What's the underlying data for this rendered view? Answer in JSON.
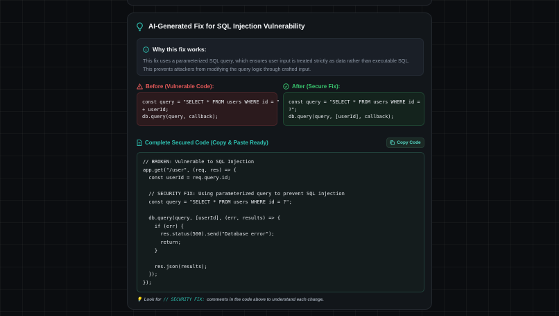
{
  "card": {
    "title": "AI-Generated Fix for SQL Injection Vulnerability",
    "title_icon": "lightbulb-icon"
  },
  "why": {
    "heading": "Why this fix works:",
    "icon": "info-icon",
    "text": "This fix uses a parameterized SQL query, which ensures user input is treated strictly as data rather than executable SQL. This prevents attackers from modifying the query logic through crafted input."
  },
  "before": {
    "label": "Before (Vulnerable Code):",
    "icon": "warning-triangle-icon",
    "code": "const query = \"SELECT * FROM users WHERE id = \"\n+ userId;\ndb.query(query, callback);"
  },
  "after": {
    "label": "After (Secure Fix):",
    "icon": "check-circle-icon",
    "code": "const query = \"SELECT * FROM users WHERE id =\n?\";\ndb.query(query, [userId], callback);"
  },
  "complete": {
    "label": "Complete Secured Code (Copy & Paste Ready)",
    "icon": "document-icon",
    "copy_button": "Copy Code",
    "copy_icon": "copy-icon",
    "code": "// BROKEN: Vulnerable to SQL Injection\napp.get(\"/user\", (req, res) => {\n  const userId = req.query.id;\n\n  // SECURITY FIX: Using parameterized query to prevent SQL injection\n  const query = \"SELECT * FROM users WHERE id = ?\";\n\n  db.query(query, [userId], (err, results) => {\n    if (err) {\n      res.status(500).send(\"Database error\");\n      return;\n    }\n\n    res.json(results);\n  });\n});"
  },
  "tip": {
    "emoji": "💡",
    "prefix": "Look for",
    "code": "// SECURITY FIX:",
    "suffix": "comments in the code above to understand each change."
  },
  "colors": {
    "accent_teal": "#2fc4b4",
    "danger": "#e05858",
    "success": "#38c46e"
  }
}
